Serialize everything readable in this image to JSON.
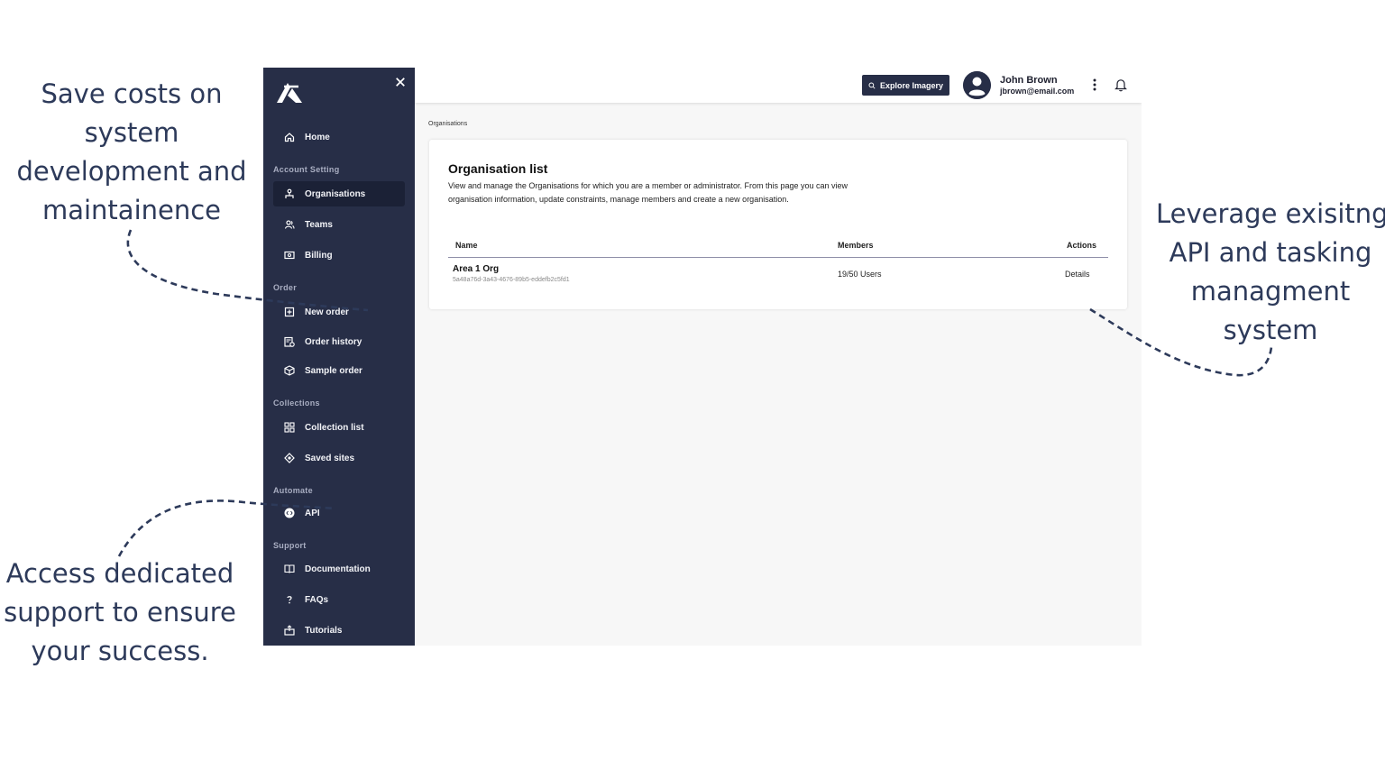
{
  "annotations": {
    "top_left": [
      "Save costs on",
      "system",
      "development and",
      "maintainence"
    ],
    "right": [
      "Leverage exisitng",
      "API and tasking",
      "managment",
      "system"
    ],
    "bottom_left": [
      "Access dedicated",
      "support to ensure",
      "your success."
    ]
  },
  "sidebar": {
    "close_icon": "close-icon",
    "items_top": [
      {
        "label": "Home",
        "icon": "home-icon"
      }
    ],
    "sections": [
      {
        "title": "Account Setting",
        "items": [
          {
            "label": "Organisations",
            "icon": "organisation-icon",
            "active": true
          },
          {
            "label": "Teams",
            "icon": "teams-icon"
          },
          {
            "label": "Billing",
            "icon": "billing-icon"
          }
        ]
      },
      {
        "title": "Order",
        "items": [
          {
            "label": "New order",
            "icon": "new-order-icon"
          },
          {
            "label": "Order history",
            "icon": "order-history-icon"
          },
          {
            "label": "Sample order",
            "icon": "sample-order-icon"
          }
        ]
      },
      {
        "title": "Collections",
        "items": [
          {
            "label": "Collection list",
            "icon": "collection-list-icon"
          },
          {
            "label": "Saved sites",
            "icon": "saved-sites-icon"
          }
        ]
      },
      {
        "title": "Automate",
        "items": [
          {
            "label": "API",
            "icon": "api-icon"
          }
        ]
      },
      {
        "title": "Support",
        "items": [
          {
            "label": "Documentation",
            "icon": "documentation-icon"
          },
          {
            "label": "FAQs",
            "icon": "faq-icon"
          },
          {
            "label": "Tutorials",
            "icon": "tutorials-icon"
          }
        ]
      }
    ]
  },
  "topbar": {
    "explore_label": "Explore Imagery",
    "user_name": "John Brown",
    "user_email": "jbrown@email.com"
  },
  "breadcrumb": "Organisations",
  "card": {
    "title": "Organisation list",
    "description_1": "View and manage the Organisations for which you are a member or administrator. From this page you can view",
    "description_2": "organisation information, update constraints, manage members and create a new organisation.",
    "columns": [
      "Name",
      "Members",
      "Actions"
    ],
    "rows": [
      {
        "name": "Area 1 Org",
        "id": "5a48a76d-3a43-4676-89b5-eddefb2c5fd1",
        "members": "19/50 Users",
        "action": "Details"
      }
    ]
  },
  "colors": {
    "sidebar": "#272e47",
    "annotation_text": "#2d3a5a",
    "content_bg": "#f7f7f7"
  }
}
